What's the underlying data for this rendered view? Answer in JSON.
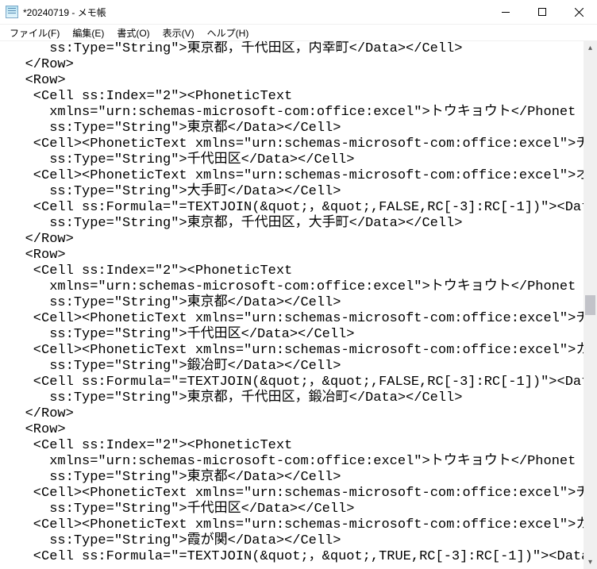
{
  "window": {
    "title": "*20240719 - メモ帳"
  },
  "menubar": {
    "items": [
      {
        "label": "ファイル(F)"
      },
      {
        "label": "編集(E)"
      },
      {
        "label": "書式(O)"
      },
      {
        "label": "表示(V)"
      },
      {
        "label": "ヘルプ(H)"
      }
    ]
  },
  "editor": {
    "text": "      ss:Type=\"String\">東京都，千代田区，内幸町</Data></Cell>\n   </Row>\n   <Row>\n    <Cell ss:Index=\"2\"><PhoneticText\n      xmlns=\"urn:schemas-microsoft-com:office:excel\">トウキョウト</Phonet\n      ss:Type=\"String\">東京都</Data></Cell>\n    <Cell><PhoneticText xmlns=\"urn:schemas-microsoft-com:office:excel\">チ\n      ss:Type=\"String\">千代田区</Data></Cell>\n    <Cell><PhoneticText xmlns=\"urn:schemas-microsoft-com:office:excel\">オ\n      ss:Type=\"String\">大手町</Data></Cell>\n    <Cell ss:Formula=\"=TEXTJOIN(&quot;，&quot;,FALSE,RC[-3]:RC[-1])\"><Data\n      ss:Type=\"String\">東京都，千代田区，大手町</Data></Cell>\n   </Row>\n   <Row>\n    <Cell ss:Index=\"2\"><PhoneticText\n      xmlns=\"urn:schemas-microsoft-com:office:excel\">トウキョウト</Phonet\n      ss:Type=\"String\">東京都</Data></Cell>\n    <Cell><PhoneticText xmlns=\"urn:schemas-microsoft-com:office:excel\">チ\n      ss:Type=\"String\">千代田区</Data></Cell>\n    <Cell><PhoneticText xmlns=\"urn:schemas-microsoft-com:office:excel\">カ\n      ss:Type=\"String\">鍛冶町</Data></Cell>\n    <Cell ss:Formula=\"=TEXTJOIN(&quot;，&quot;,FALSE,RC[-3]:RC[-1])\"><Data\n      ss:Type=\"String\">東京都，千代田区，鍛冶町</Data></Cell>\n   </Row>\n   <Row>\n    <Cell ss:Index=\"2\"><PhoneticText\n      xmlns=\"urn:schemas-microsoft-com:office:excel\">トウキョウト</Phonet\n      ss:Type=\"String\">東京都</Data></Cell>\n    <Cell><PhoneticText xmlns=\"urn:schemas-microsoft-com:office:excel\">チ\n      ss:Type=\"String\">千代田区</Data></Cell>\n    <Cell><PhoneticText xmlns=\"urn:schemas-microsoft-com:office:excel\">カ\n      ss:Type=\"String\">霞が関</Data></Cell>\n    <Cell ss:Formula=\"=TEXTJOIN(&quot;，&quot;,TRUE,RC[-3]:RC[-1])\"><Data"
  }
}
